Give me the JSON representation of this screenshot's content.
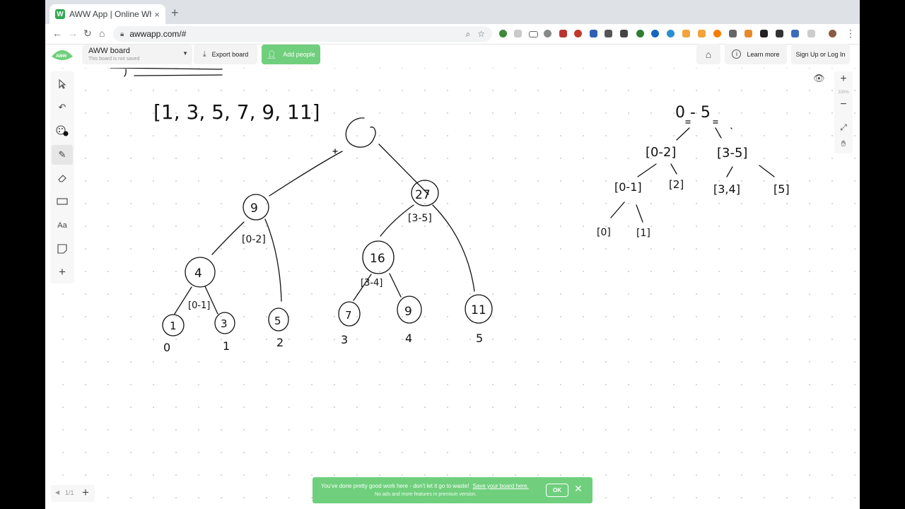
{
  "browser": {
    "tab_title": "AWW App | Online Whiteboard",
    "tab_close": "×",
    "new_tab": "+",
    "url": "awwapp.com/#",
    "favicon_letter": "W"
  },
  "header": {
    "board_name": "AWW board",
    "board_status": "This board is not saved",
    "export_label": "Export board",
    "add_people_label": "Add people",
    "learn_more_label": "Learn more",
    "sign_up_label": "Sign Up or Log In"
  },
  "zoom": {
    "level": "100%",
    "plus": "+",
    "minus": "−"
  },
  "pager": {
    "page": "1/1",
    "add": "+"
  },
  "banner": {
    "message": "You've done pretty good work here - don't let it go to waste!",
    "link": "Save your board here.",
    "sub": "No ads and more features in premium version.",
    "ok": "OK",
    "close": "✕"
  },
  "whiteboard": {
    "array_text": "[1, 3, 5, 7, 9, 11]",
    "root_range": "0 - 5",
    "tree_nodes": [
      "9",
      "27",
      "4",
      "16",
      "1",
      "3",
      "5",
      "7",
      "9",
      "11"
    ],
    "tree_ranges": [
      "[0-2]",
      "[3-5]",
      "[0-1]",
      "[3-4]"
    ],
    "leaf_indices": [
      "0",
      "1",
      "2",
      "3",
      "4",
      "5"
    ],
    "right_ranges": [
      "[0-2]",
      "[3-5]",
      "[0-1]",
      "[2]",
      "[3,4]",
      "[5]",
      "[0]",
      "[1]"
    ]
  },
  "colors": {
    "accent_green": "#6fcf7c",
    "ink": "#111111"
  }
}
